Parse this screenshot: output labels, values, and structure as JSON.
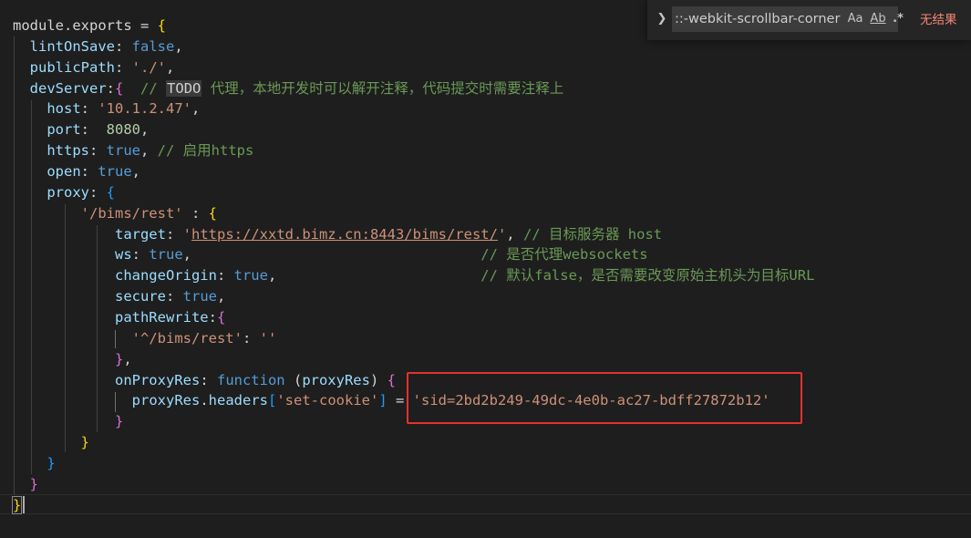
{
  "colors": {
    "background": "#1e1e1e",
    "plain": "#d4d4d4",
    "property": "#9cdcfe",
    "keyword": "#569cd6",
    "string": "#ce9178",
    "number": "#b5cea8",
    "comment": "#6a9955",
    "bracket_gold": "#ffd700",
    "bracket_pink": "#da70d6",
    "bracket_blue": "#179fff",
    "highlight_box": "#e5312d",
    "no_results": "#f48771"
  },
  "find_widget": {
    "toggle_icon": "chevron-right-icon",
    "query": "::-webkit-scrollbar-corner",
    "match_case_icon": "Aa",
    "whole_word_icon": "Ab",
    "regex_icon": ".*",
    "result_text": "无结果"
  },
  "code": {
    "lines": [
      [
        [
          "module",
          "plain"
        ],
        [
          ".",
          "plain"
        ],
        [
          "exports",
          "plain"
        ],
        [
          " = ",
          "plain"
        ],
        [
          "{",
          "bracket_gold"
        ]
      ],
      [
        [
          "  ",
          "plain"
        ],
        [
          "lintOnSave",
          "property"
        ],
        [
          ": ",
          "plain"
        ],
        [
          "false",
          "keyword"
        ],
        [
          ",",
          "plain"
        ]
      ],
      [
        [
          "  ",
          "plain"
        ],
        [
          "publicPath",
          "property"
        ],
        [
          ": ",
          "plain"
        ],
        [
          "'./'",
          "string"
        ],
        [
          ",",
          "plain"
        ]
      ],
      [
        [
          "  ",
          "plain"
        ],
        [
          "devServer",
          "property"
        ],
        [
          ":",
          "plain"
        ],
        [
          "{",
          "bracket_pink"
        ],
        [
          "  // ",
          "comment"
        ],
        [
          "TODO",
          "todo"
        ],
        [
          " 代理，本地开发时可以解开注释，代码提交时需要注释上",
          "comment"
        ]
      ],
      [
        [
          "    ",
          "plain"
        ],
        [
          "host",
          "property"
        ],
        [
          ": ",
          "plain"
        ],
        [
          "'10.1.2.47'",
          "string"
        ],
        [
          ",",
          "plain"
        ]
      ],
      [
        [
          "    ",
          "plain"
        ],
        [
          "port",
          "property"
        ],
        [
          ":  ",
          "plain"
        ],
        [
          "8080",
          "number"
        ],
        [
          ",",
          "plain"
        ]
      ],
      [
        [
          "    ",
          "plain"
        ],
        [
          "https",
          "property"
        ],
        [
          ": ",
          "plain"
        ],
        [
          "true",
          "keyword"
        ],
        [
          ", ",
          "plain"
        ],
        [
          "// 启用https",
          "comment"
        ]
      ],
      [
        [
          "    ",
          "plain"
        ],
        [
          "open",
          "property"
        ],
        [
          ": ",
          "plain"
        ],
        [
          "true",
          "keyword"
        ],
        [
          ",",
          "plain"
        ]
      ],
      [
        [
          "    ",
          "plain"
        ],
        [
          "proxy",
          "property"
        ],
        [
          ": ",
          "plain"
        ],
        [
          "{",
          "bracket_blue"
        ]
      ],
      [
        [
          "        ",
          "plain"
        ],
        [
          "'/bims/rest'",
          "string"
        ],
        [
          " : ",
          "plain"
        ],
        [
          "{",
          "bracket_gold"
        ]
      ],
      [
        [
          "            ",
          "plain"
        ],
        [
          "target",
          "property"
        ],
        [
          ": ",
          "plain"
        ],
        [
          "'",
          "string"
        ],
        [
          "https://xxtd.bimz.cn:8443/bims/rest/",
          "string_link"
        ],
        [
          "'",
          "string"
        ],
        [
          ", ",
          "plain"
        ],
        [
          "// 目标服务器 host",
          "comment"
        ]
      ],
      [
        [
          "            ",
          "plain"
        ],
        [
          "ws",
          "property"
        ],
        [
          ": ",
          "plain"
        ],
        [
          "true",
          "keyword"
        ],
        [
          ",",
          "plain"
        ],
        [
          "                                  // 是否代理websockets",
          "comment"
        ]
      ],
      [
        [
          "            ",
          "plain"
        ],
        [
          "changeOrigin",
          "property"
        ],
        [
          ": ",
          "plain"
        ],
        [
          "true",
          "keyword"
        ],
        [
          ",",
          "plain"
        ],
        [
          "                        // 默认false，是否需要改变原始主机头为目标URL",
          "comment"
        ]
      ],
      [
        [
          "            ",
          "plain"
        ],
        [
          "secure",
          "property"
        ],
        [
          ": ",
          "plain"
        ],
        [
          "true",
          "keyword"
        ],
        [
          ",",
          "plain"
        ]
      ],
      [
        [
          "            ",
          "plain"
        ],
        [
          "pathRewrite",
          "property"
        ],
        [
          ":",
          "plain"
        ],
        [
          "{",
          "bracket_pink"
        ]
      ],
      [
        [
          "              ",
          "plain"
        ],
        [
          "'^/bims/rest'",
          "string"
        ],
        [
          ": ",
          "plain"
        ],
        [
          "''",
          "string"
        ]
      ],
      [
        [
          "            ",
          "plain"
        ],
        [
          "}",
          "bracket_pink"
        ],
        [
          ",",
          "plain"
        ]
      ],
      [
        [
          "            ",
          "plain"
        ],
        [
          "onProxyRes",
          "property"
        ],
        [
          ": ",
          "plain"
        ],
        [
          "function",
          "keyword"
        ],
        [
          " (",
          "plain"
        ],
        [
          "proxyRes",
          "property"
        ],
        [
          ") ",
          "plain"
        ],
        [
          "{",
          "bracket_pink"
        ]
      ],
      [
        [
          "              ",
          "plain"
        ],
        [
          "proxyRes",
          "property"
        ],
        [
          ".",
          "plain"
        ],
        [
          "headers",
          "property"
        ],
        [
          "[",
          "bracket_blue"
        ],
        [
          "'set-cookie'",
          "string"
        ],
        [
          "]",
          "bracket_blue"
        ],
        [
          " = ",
          "plain"
        ],
        [
          "'sid=2bd2b249-49dc-4e0b-ac27-bdff27872b12'",
          "string"
        ]
      ],
      [
        [
          "            ",
          "plain"
        ],
        [
          "}",
          "bracket_pink"
        ]
      ],
      [
        [
          "        ",
          "plain"
        ],
        [
          "}",
          "bracket_gold"
        ]
      ],
      [
        [
          "    ",
          "plain"
        ],
        [
          "}",
          "bracket_blue"
        ]
      ],
      [
        [
          "  ",
          "plain"
        ],
        [
          "}",
          "bracket_pink"
        ]
      ],
      [
        [
          "}",
          "bracket_gold_match"
        ]
      ]
    ]
  }
}
